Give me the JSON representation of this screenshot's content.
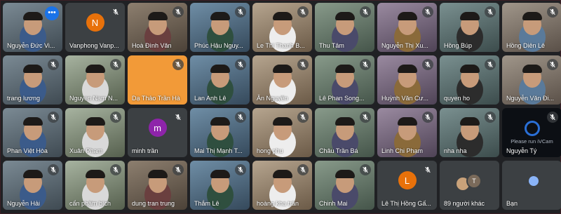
{
  "meeting": {
    "accent_color": "#1a73e8",
    "tiles": [
      {
        "name": "Nguyễn Đức Vi...",
        "type": "video",
        "muted": false,
        "pinned_menu": true
      },
      {
        "name": "Vanphong Vanp...",
        "type": "avatar",
        "initial": "N",
        "avatar_color": "#e8710a",
        "muted": true
      },
      {
        "name": "Hoà Đình Văn",
        "type": "video",
        "muted": true
      },
      {
        "name": "Phúc Hậu Nguy...",
        "type": "video",
        "muted": true
      },
      {
        "name": "Le Thi Thanh B...",
        "type": "video",
        "muted": true
      },
      {
        "name": "Thu Tâm",
        "type": "video",
        "muted": true
      },
      {
        "name": "Nguyễn Thị Xu...",
        "type": "video",
        "muted": true
      },
      {
        "name": "Hồng Búp",
        "type": "video",
        "muted": true
      },
      {
        "name": "Hồng Diên Lê",
        "type": "video",
        "muted": true
      },
      {
        "name": "trang lương",
        "type": "video",
        "muted": true
      },
      {
        "name": "Nguyen Nam N...",
        "type": "video",
        "muted": true
      },
      {
        "name": "Dạ Thảo Trần Hà",
        "type": "plain",
        "muted": true
      },
      {
        "name": "Lan Anh Lê",
        "type": "video",
        "muted": true
      },
      {
        "name": "Ân Nguyễn",
        "type": "video",
        "muted": true
      },
      {
        "name": "Lê Phan Song...",
        "type": "video",
        "muted": true
      },
      {
        "name": "Huỳnh Văn Cư...",
        "type": "video",
        "muted": true
      },
      {
        "name": "quyen ho",
        "type": "video",
        "muted": true
      },
      {
        "name": "Nguyễn Văn Đi...",
        "type": "video",
        "muted": true
      },
      {
        "name": "Phan Việt Hòa",
        "type": "video",
        "muted": true
      },
      {
        "name": "Xuân Phạm",
        "type": "video",
        "muted": true
      },
      {
        "name": "minh trần",
        "type": "avatar",
        "initial": "m",
        "avatar_color": "#8e24aa",
        "muted": true
      },
      {
        "name": "Mai Thị Mạnh T...",
        "type": "video",
        "muted": true
      },
      {
        "name": "hong phu",
        "type": "video",
        "muted": true
      },
      {
        "name": "Châu Trần Bá",
        "type": "video",
        "muted": true
      },
      {
        "name": "Linh Chi Phạm",
        "type": "video",
        "muted": true
      },
      {
        "name": "nha nha",
        "type": "video",
        "muted": true
      },
      {
        "name": "Nguyễn Tý",
        "type": "ivcam",
        "ivcam_text": "Please run iVCam",
        "muted": true
      },
      {
        "name": "Nguyễn Hải",
        "type": "video",
        "muted": true
      },
      {
        "name": "cẩn phẩm bích",
        "type": "video",
        "muted": true
      },
      {
        "name": "dung tran trung",
        "type": "video",
        "muted": true
      },
      {
        "name": "Thắm Lê",
        "type": "video",
        "muted": true
      },
      {
        "name": "hoàng kha trân",
        "type": "video",
        "muted": true
      },
      {
        "name": "Chinh Mai",
        "type": "video",
        "muted": true
      },
      {
        "name": "Lê Thị Hồng Gấ...",
        "type": "avatar",
        "initial": "L",
        "avatar_color": "#e8710a",
        "muted": true
      },
      {
        "name": "89 người khác",
        "type": "others"
      },
      {
        "name": "Bạn",
        "type": "self"
      }
    ]
  }
}
